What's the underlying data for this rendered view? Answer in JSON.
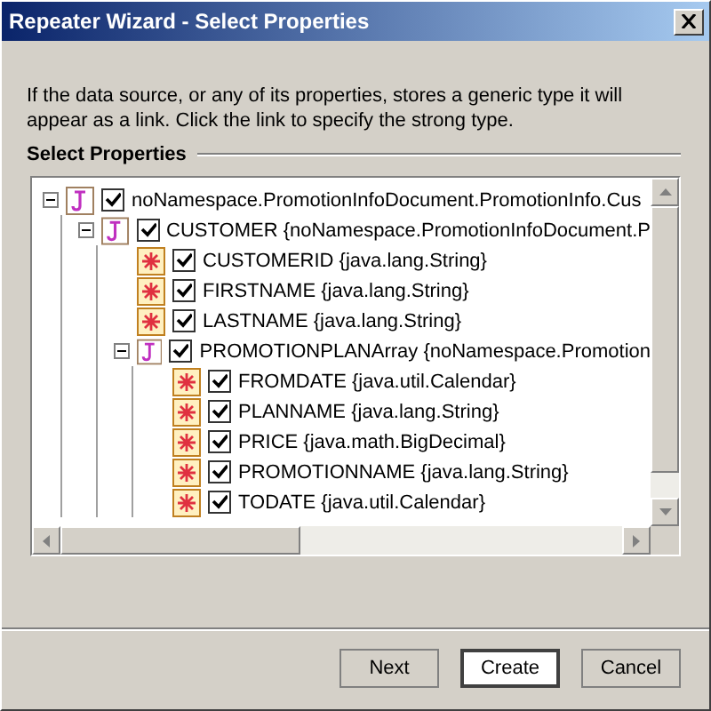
{
  "window": {
    "title": "Repeater Wizard - Select Properties"
  },
  "description": "If the data source, or any of its properties, stores a generic type it will appear as a link. Click the link to specify the strong type.",
  "group_label": "Select Properties",
  "tree": [
    {
      "kind": "class",
      "label": "noNamespace.PromotionInfoDocument.PromotionInfo.Cus",
      "checked": true,
      "expanded": true,
      "children": [
        {
          "kind": "class",
          "label": "CUSTOMER {noNamespace.PromotionInfoDocument.P",
          "checked": true,
          "expanded": true,
          "children": [
            {
              "kind": "field",
              "label": "CUSTOMERID {java.lang.String}",
              "checked": true
            },
            {
              "kind": "field",
              "label": "FIRSTNAME {java.lang.String}",
              "checked": true
            },
            {
              "kind": "field",
              "label": "LASTNAME {java.lang.String}",
              "checked": true
            },
            {
              "kind": "class",
              "label": "PROMOTIONPLANArray {noNamespace.Promotion",
              "checked": true,
              "expanded": true,
              "children": [
                {
                  "kind": "field",
                  "label": "FROMDATE {java.util.Calendar}",
                  "checked": true
                },
                {
                  "kind": "field",
                  "label": "PLANNAME {java.lang.String}",
                  "checked": true
                },
                {
                  "kind": "field",
                  "label": "PRICE {java.math.BigDecimal}",
                  "checked": true
                },
                {
                  "kind": "field",
                  "label": "PROMOTIONNAME {java.lang.String}",
                  "checked": true
                },
                {
                  "kind": "field",
                  "label": "TODATE {java.util.Calendar}",
                  "checked": true
                }
              ]
            }
          ]
        }
      ]
    }
  ],
  "buttons": [
    {
      "label": "Next",
      "default": false
    },
    {
      "label": "Create",
      "default": true
    },
    {
      "label": "Cancel",
      "default": false
    }
  ]
}
